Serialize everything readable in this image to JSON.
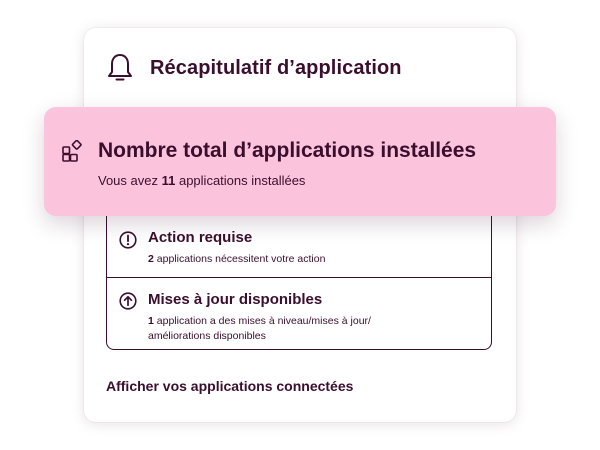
{
  "card": {
    "title": "Récapitulatif d’application",
    "icon": "bell-icon"
  },
  "highlight": {
    "title": "Nombre total d’applications installées",
    "subtitle_prefix": "Vous avez ",
    "count": "11",
    "subtitle_suffix": " applications installées",
    "icon": "apps-grid-icon",
    "background": "#fbc3dc"
  },
  "items": [
    {
      "title": "Action requise",
      "count": "2",
      "description": " applications nécessitent votre action",
      "icon": "exclamation-circle-icon"
    },
    {
      "title": "Mises à jour disponibles",
      "count": "1",
      "description": " application a des mises à niveau/mises à jour/ améliorations disponibles",
      "icon": "arrow-up-circle-icon"
    }
  ],
  "footer": {
    "link_label": "Afficher vos applications connectées"
  },
  "colors": {
    "text": "#3a0f2e",
    "card_background": "#ffffff"
  }
}
